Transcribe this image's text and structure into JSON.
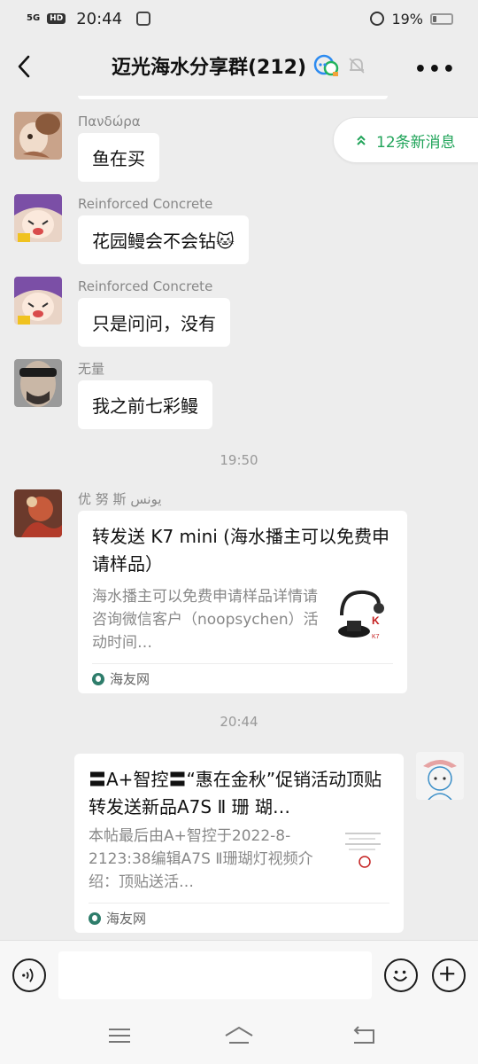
{
  "status_bar": {
    "signal": "5G",
    "hd": "HD",
    "time": "20:44",
    "battery": "19%",
    "battery_level": 0.19
  },
  "header": {
    "title": "迈光海水分享群(212)"
  },
  "new_messages": {
    "label": "12条新消息"
  },
  "messages": [
    {
      "sender": "Πανδώρα",
      "text": "鱼在买"
    },
    {
      "sender": "Reinforced Concrete",
      "text": "花园鳗会不会钻🐱"
    },
    {
      "sender": "Reinforced Concrete",
      "text": "只是问问，没有"
    },
    {
      "sender": "无量",
      "text": "我之前七彩鳗"
    }
  ],
  "timestamps": [
    "19:50",
    "20:44"
  ],
  "card1": {
    "sender": "优 努 斯  يونس",
    "title": "转发送 K7 mini (海水播主可以免费申请样品）",
    "desc": "海水播主可以免费申请样品详情请咨询微信客户（noopsychen）活动时间…",
    "source": "海友网"
  },
  "card2": {
    "title": "〓A+智控〓“惠在金秋”促销活动顶贴转发送新品A7S Ⅱ 珊 瑚…",
    "desc": "本帖最后由A+智控于2022-8-2123:38编辑A7S Ⅱ珊瑚灯视频介绍：顶贴送活…",
    "source": "海友网"
  },
  "input": {
    "placeholder": ""
  },
  "icons": {
    "back": "back-arrow-icon",
    "chat_group": "group-chat-icon",
    "mute": "mute-bell-icon",
    "more": "more-dots-icon",
    "new_msg": "double-chevron-up-icon",
    "voice": "voice-icon",
    "emoji": "emoji-icon",
    "plus": "plus-icon",
    "menu": "menu-icon",
    "home": "home-icon",
    "return": "return-icon"
  },
  "colors": {
    "accent_green": "#21a45a",
    "background": "#ededed"
  }
}
